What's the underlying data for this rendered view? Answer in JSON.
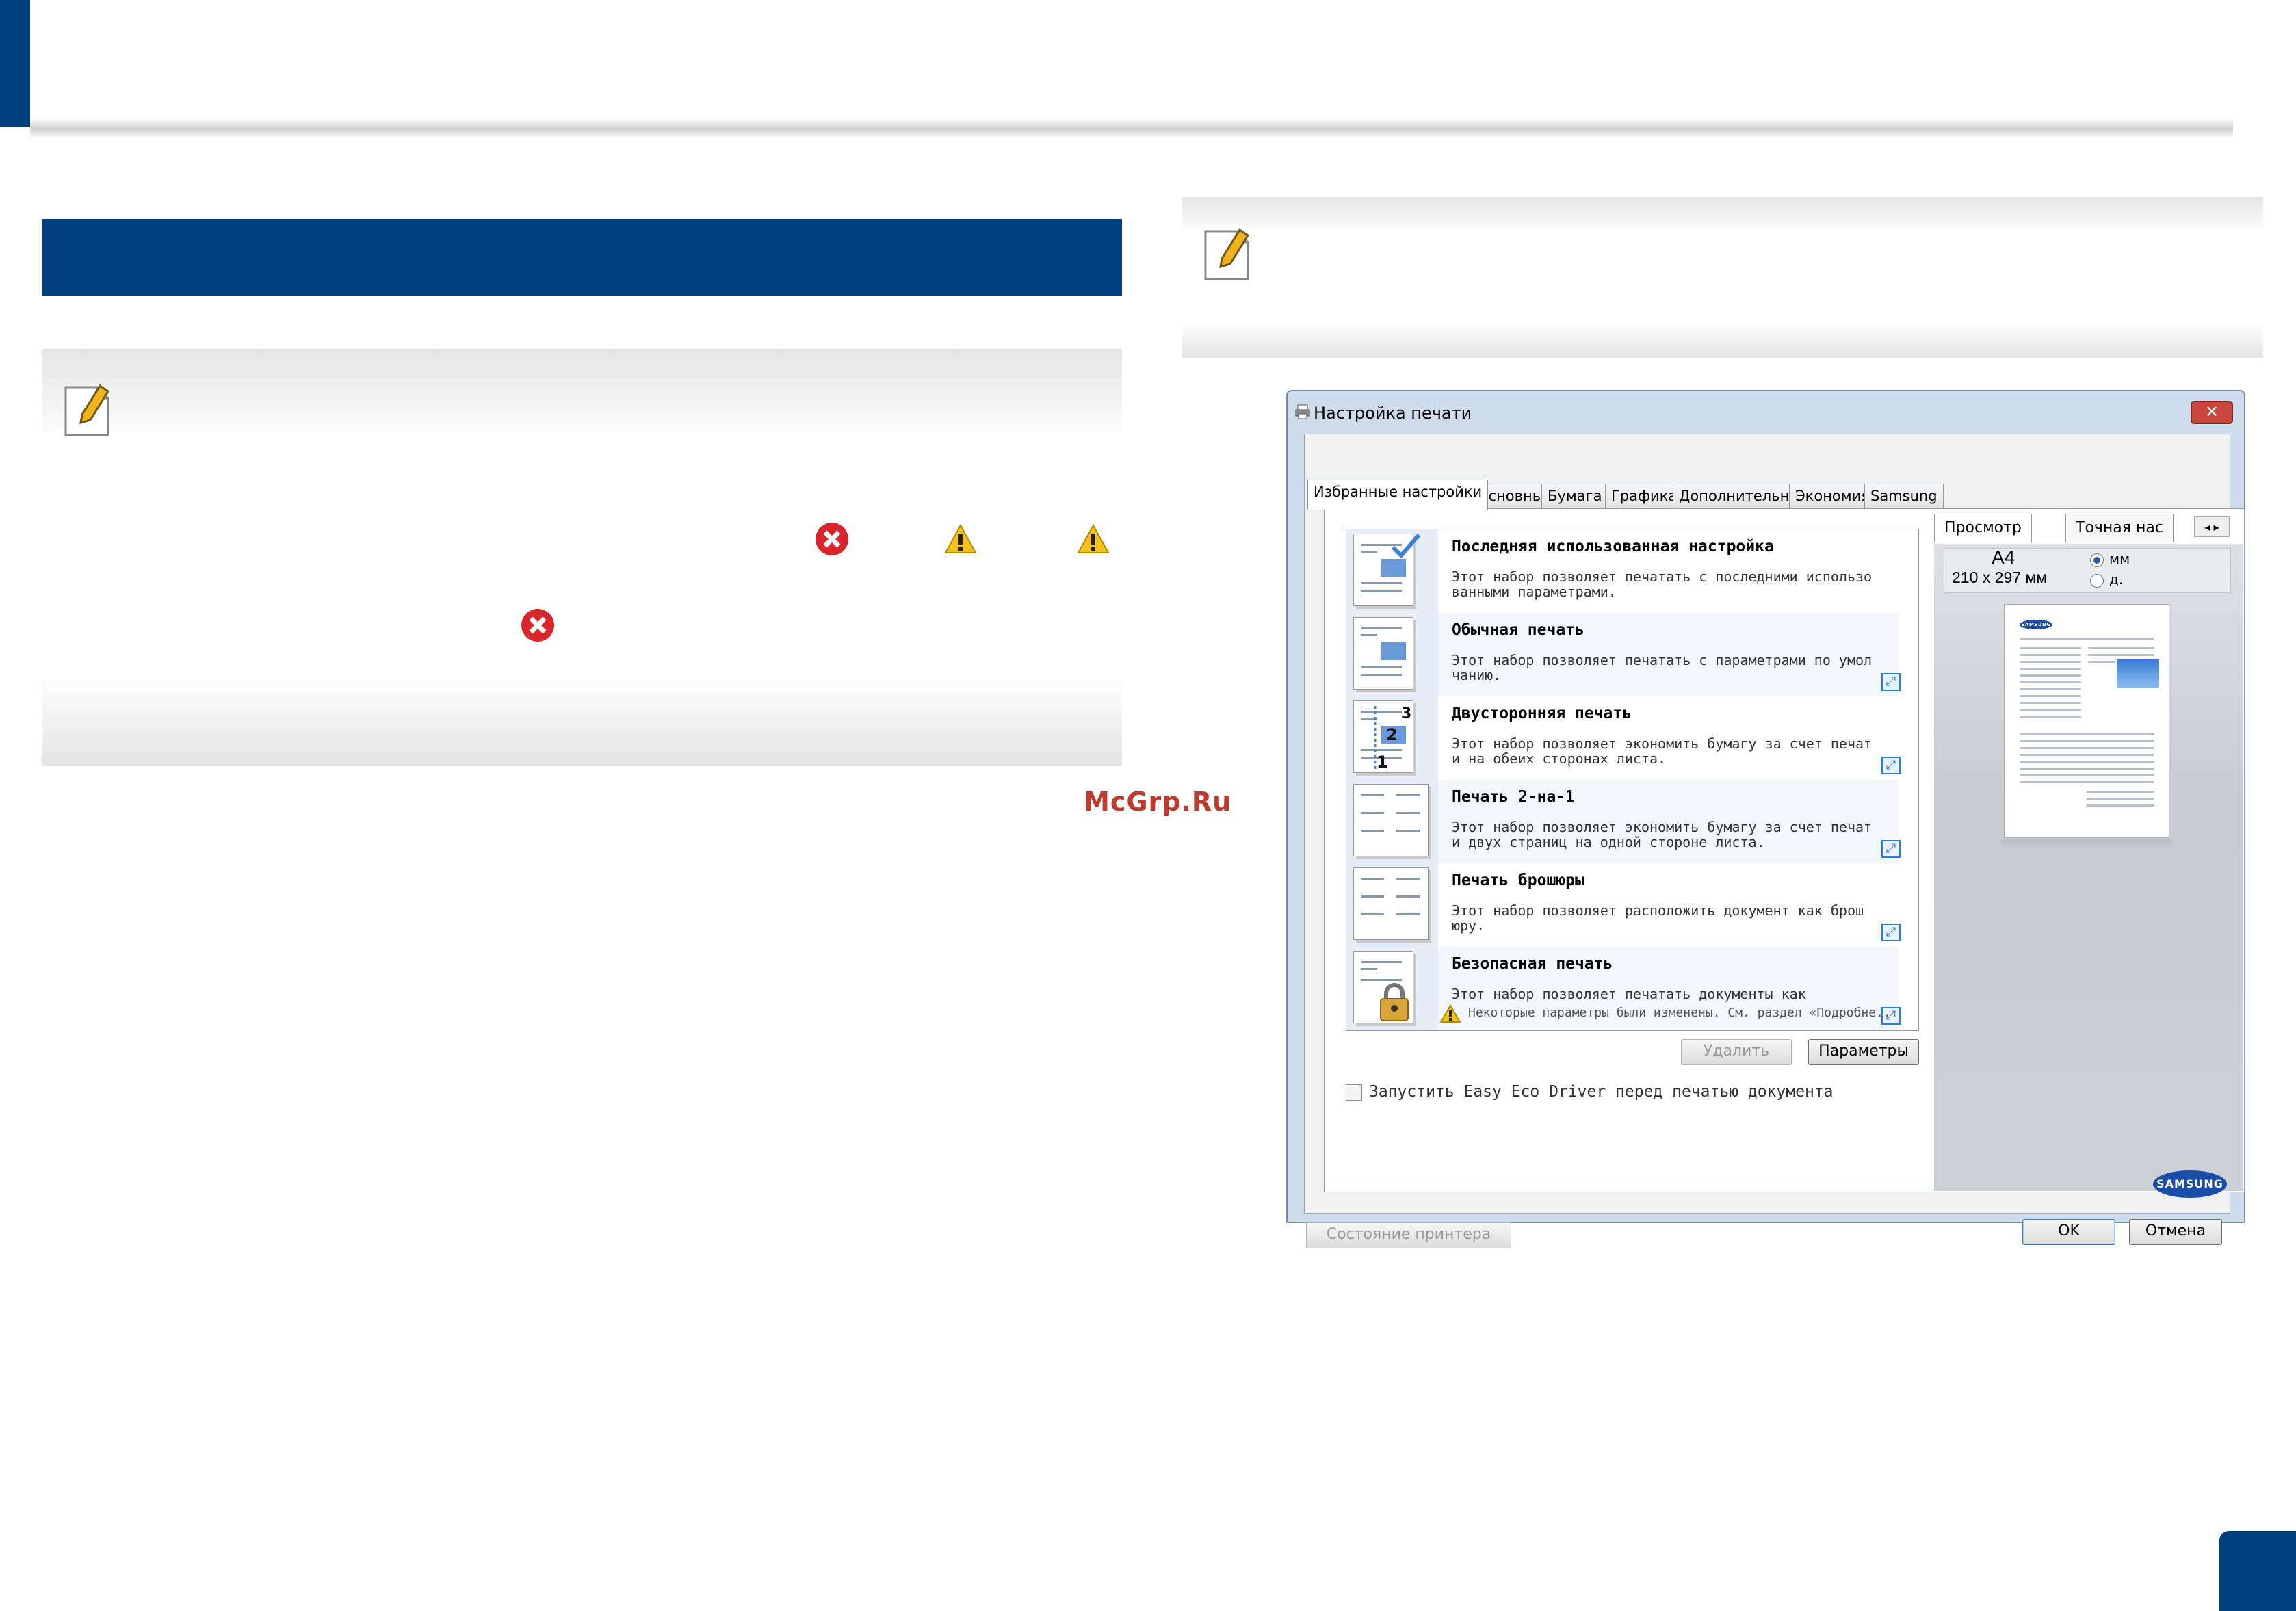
{
  "watermark": "McGrp.Ru",
  "page_number": "",
  "dialog": {
    "title": "Настройка печати",
    "close_symbol": "✕",
    "tabs": [
      "Избранные настройки",
      "Основные",
      "Бумага",
      "Графика",
      "Дополнительно",
      "Экономия",
      "Samsung"
    ],
    "favorites": [
      {
        "name": "Последняя использованная настройка",
        "desc": "Этот набор позволяет печатать с последними использо ванными параметрами."
      },
      {
        "name": "Обычная печать",
        "desc": "Этот набор позволяет печатать с параметрами по умол чанию."
      },
      {
        "name": "Двусторонняя печать",
        "desc": "Этот набор позволяет экономить бумагу за счет печат и на обеих сторонах листа."
      },
      {
        "name": "Печать 2-на-1",
        "desc": "Этот набор позволяет экономить бумагу за счет печат и двух страниц на одной стороне листа."
      },
      {
        "name": "Печать брошюры",
        "desc": "Этот набор позволяет расположить документ как брош юру."
      },
      {
        "name": "Безопасная печать",
        "desc": "Этот набор позволяет печатать документы как конфи..."
      }
    ],
    "warning_text": "Некоторые параметры были изменены. См. раздел «Подробне...",
    "delete_button": "Удалить",
    "params_button": "Параметры",
    "checkbox_label": "Запустить Easy Eco Driver перед печатью документа",
    "printer_status_button": "Состояние принтера",
    "ok_button": "OK",
    "cancel_button": "Отмена",
    "preview": {
      "tabs": [
        "Просмотр",
        "Точная нас"
      ],
      "paper": "A4",
      "dimensions": "210 x 297 мм",
      "unit_mm": "мм",
      "unit_inch": "д.",
      "brand": "SAMSUNG"
    }
  },
  "colors": {
    "accent": "#003e7e",
    "error": "#d9262c",
    "warning": "#f2c21b"
  }
}
